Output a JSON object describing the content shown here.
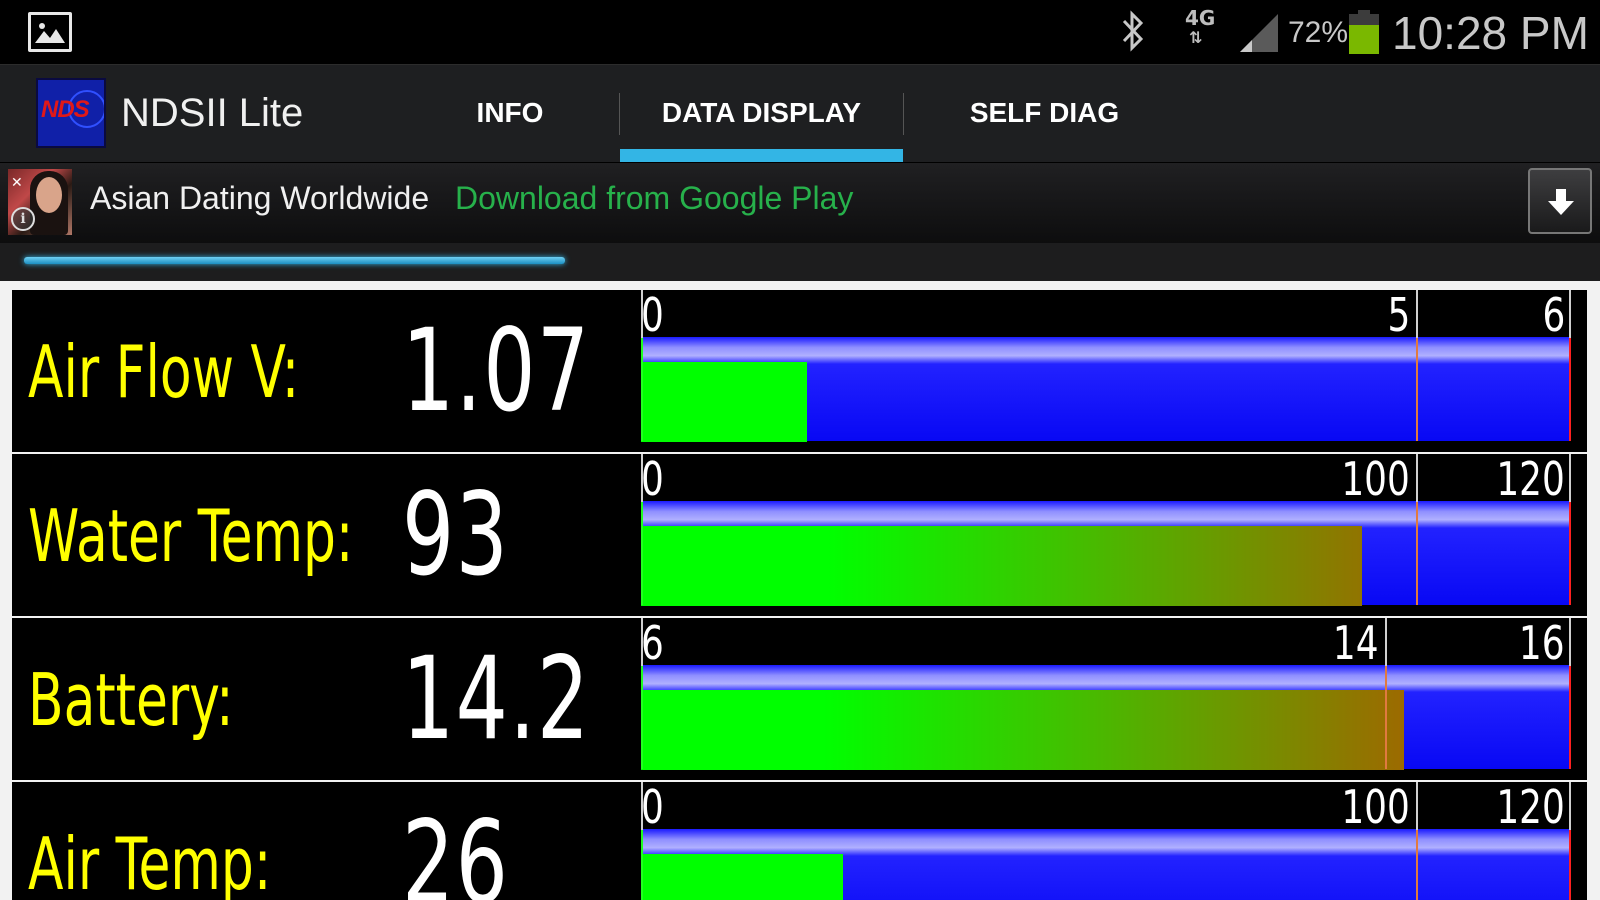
{
  "status_bar": {
    "network_type": "4G",
    "battery_percent": "72%",
    "battery_level": 0.72,
    "time": "10:28 PM",
    "colors": {
      "battery_fill": "#7ab800"
    }
  },
  "app_bar": {
    "logo_text": "NDS",
    "title": "NDSII Lite",
    "tabs": [
      {
        "label": "INFO",
        "selected": false
      },
      {
        "label": "DATA DISPLAY",
        "selected": true
      },
      {
        "label": "SELF DIAG",
        "selected": false
      }
    ],
    "colors": {
      "tab_indicator": "#33b5e5"
    }
  },
  "ad": {
    "title": "Asian Dating Worldwide",
    "cta": "Download from Google Play",
    "icons": [
      "info-icon",
      "close-icon",
      "download-icon"
    ],
    "colors": {
      "cta": "#27b14b"
    }
  },
  "progress": {
    "value": 0.58
  },
  "gauges": [
    {
      "label": "Air Flow V:",
      "value": "1.07",
      "numeric": 1.07,
      "min": 0,
      "max": 6,
      "warn": 5,
      "ticks": [
        {
          "v": 0,
          "text": "0"
        },
        {
          "v": 5,
          "text": "5"
        },
        {
          "v": 6,
          "text": "6"
        }
      ]
    },
    {
      "label": "Water Temp:",
      "value": "93",
      "numeric": 93,
      "min": 0,
      "max": 120,
      "warn": 100,
      "ticks": [
        {
          "v": 0,
          "text": "0"
        },
        {
          "v": 100,
          "text": "100"
        },
        {
          "v": 120,
          "text": "120"
        }
      ]
    },
    {
      "label": "Battery:",
      "value": "14.2",
      "numeric": 14.2,
      "min": 6,
      "max": 16,
      "warn": 14,
      "ticks": [
        {
          "v": 6,
          "text": "6"
        },
        {
          "v": 14,
          "text": "14"
        },
        {
          "v": 16,
          "text": "16"
        }
      ]
    },
    {
      "label": "Air Temp:",
      "value": "26",
      "numeric": 26,
      "min": 0,
      "max": 120,
      "warn": 100,
      "ticks": [
        {
          "v": 0,
          "text": "0"
        },
        {
          "v": 100,
          "text": "100"
        },
        {
          "v": 120,
          "text": "120"
        }
      ]
    }
  ],
  "colors": {
    "label": "#ffff00",
    "value": "#ffffff",
    "track": "#0808f4",
    "fill_low": "#00ff00",
    "fill_high": "#c84000",
    "warn_line": "#e07a40",
    "max_line": "#ff2020"
  }
}
